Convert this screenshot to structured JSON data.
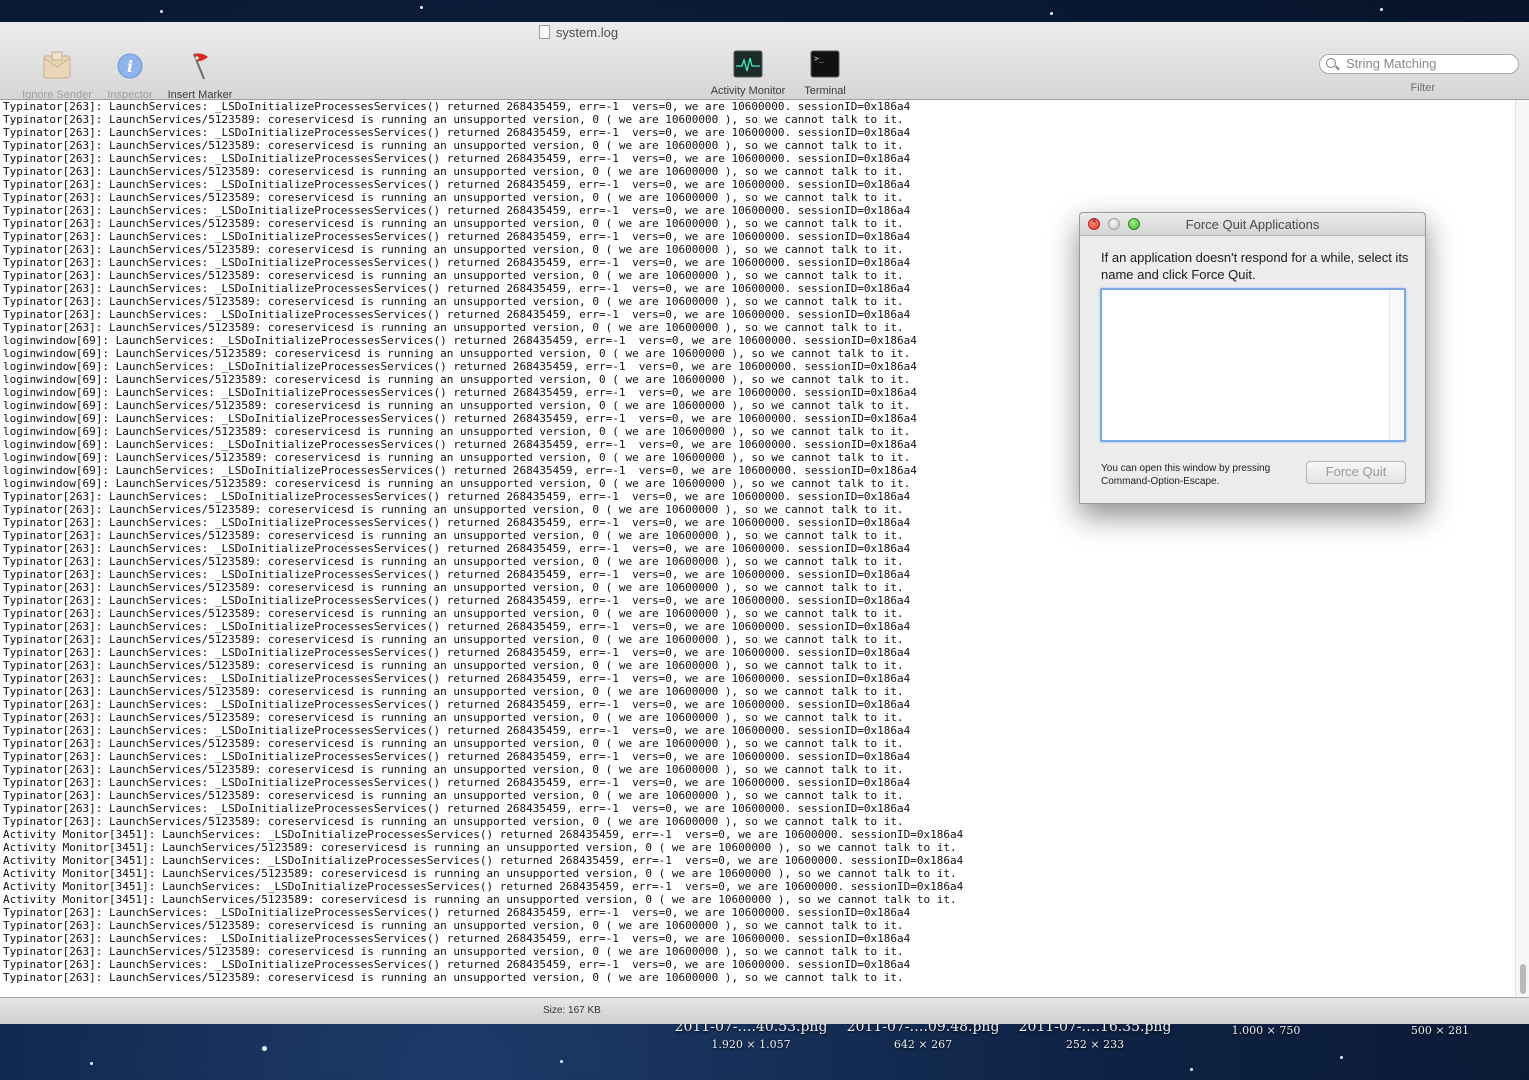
{
  "window": {
    "title": "system.log"
  },
  "toolbar": {
    "ignore_sender": "Ignore Sender",
    "inspector": "Inspector",
    "insert_marker": "Insert Marker",
    "activity_monitor": "Activity Monitor",
    "terminal": "Terminal"
  },
  "search": {
    "placeholder": "String Matching",
    "label": "Filter"
  },
  "log_lines": [
    "Typinator[263]: LaunchServices: _LSDoInitializeProcessesServices() returned 268435459, err=-1  vers=0, we are 10600000. sessionID=0x186a4",
    "Typinator[263]: LaunchServices/5123589: coreservicesd is running an unsupported version, 0 ( we are 10600000 ), so we cannot talk to it.",
    "Typinator[263]: LaunchServices: _LSDoInitializeProcessesServices() returned 268435459, err=-1  vers=0, we are 10600000. sessionID=0x186a4",
    "Typinator[263]: LaunchServices/5123589: coreservicesd is running an unsupported version, 0 ( we are 10600000 ), so we cannot talk to it.",
    "Typinator[263]: LaunchServices: _LSDoInitializeProcessesServices() returned 268435459, err=-1  vers=0, we are 10600000. sessionID=0x186a4",
    "Typinator[263]: LaunchServices/5123589: coreservicesd is running an unsupported version, 0 ( we are 10600000 ), so we cannot talk to it.",
    "Typinator[263]: LaunchServices: _LSDoInitializeProcessesServices() returned 268435459, err=-1  vers=0, we are 10600000. sessionID=0x186a4",
    "Typinator[263]: LaunchServices/5123589: coreservicesd is running an unsupported version, 0 ( we are 10600000 ), so we cannot talk to it.",
    "Typinator[263]: LaunchServices: _LSDoInitializeProcessesServices() returned 268435459, err=-1  vers=0, we are 10600000. sessionID=0x186a4",
    "Typinator[263]: LaunchServices/5123589: coreservicesd is running an unsupported version, 0 ( we are 10600000 ), so we cannot talk to it.",
    "Typinator[263]: LaunchServices: _LSDoInitializeProcessesServices() returned 268435459, err=-1  vers=0, we are 10600000. sessionID=0x186a4",
    "Typinator[263]: LaunchServices/5123589: coreservicesd is running an unsupported version, 0 ( we are 10600000 ), so we cannot talk to it.",
    "Typinator[263]: LaunchServices: _LSDoInitializeProcessesServices() returned 268435459, err=-1  vers=0, we are 10600000. sessionID=0x186a4",
    "Typinator[263]: LaunchServices/5123589: coreservicesd is running an unsupported version, 0 ( we are 10600000 ), so we cannot talk to it.",
    "Typinator[263]: LaunchServices: _LSDoInitializeProcessesServices() returned 268435459, err=-1  vers=0, we are 10600000. sessionID=0x186a4",
    "Typinator[263]: LaunchServices/5123589: coreservicesd is running an unsupported version, 0 ( we are 10600000 ), so we cannot talk to it.",
    "Typinator[263]: LaunchServices: _LSDoInitializeProcessesServices() returned 268435459, err=-1  vers=0, we are 10600000. sessionID=0x186a4",
    "Typinator[263]: LaunchServices/5123589: coreservicesd is running an unsupported version, 0 ( we are 10600000 ), so we cannot talk to it.",
    "loginwindow[69]: LaunchServices: _LSDoInitializeProcessesServices() returned 268435459, err=-1  vers=0, we are 10600000. sessionID=0x186a4",
    "loginwindow[69]: LaunchServices/5123589: coreservicesd is running an unsupported version, 0 ( we are 10600000 ), so we cannot talk to it.",
    "loginwindow[69]: LaunchServices: _LSDoInitializeProcessesServices() returned 268435459, err=-1  vers=0, we are 10600000. sessionID=0x186a4",
    "loginwindow[69]: LaunchServices/5123589: coreservicesd is running an unsupported version, 0 ( we are 10600000 ), so we cannot talk to it.",
    "loginwindow[69]: LaunchServices: _LSDoInitializeProcessesServices() returned 268435459, err=-1  vers=0, we are 10600000. sessionID=0x186a4",
    "loginwindow[69]: LaunchServices/5123589: coreservicesd is running an unsupported version, 0 ( we are 10600000 ), so we cannot talk to it.",
    "loginwindow[69]: LaunchServices: _LSDoInitializeProcessesServices() returned 268435459, err=-1  vers=0, we are 10600000. sessionID=0x186a4",
    "loginwindow[69]: LaunchServices/5123589: coreservicesd is running an unsupported version, 0 ( we are 10600000 ), so we cannot talk to it.",
    "loginwindow[69]: LaunchServices: _LSDoInitializeProcessesServices() returned 268435459, err=-1  vers=0, we are 10600000. sessionID=0x186a4",
    "loginwindow[69]: LaunchServices/5123589: coreservicesd is running an unsupported version, 0 ( we are 10600000 ), so we cannot talk to it.",
    "loginwindow[69]: LaunchServices: _LSDoInitializeProcessesServices() returned 268435459, err=-1  vers=0, we are 10600000. sessionID=0x186a4",
    "loginwindow[69]: LaunchServices/5123589: coreservicesd is running an unsupported version, 0 ( we are 10600000 ), so we cannot talk to it.",
    "Typinator[263]: LaunchServices: _LSDoInitializeProcessesServices() returned 268435459, err=-1  vers=0, we are 10600000. sessionID=0x186a4",
    "Typinator[263]: LaunchServices/5123589: coreservicesd is running an unsupported version, 0 ( we are 10600000 ), so we cannot talk to it.",
    "Typinator[263]: LaunchServices: _LSDoInitializeProcessesServices() returned 268435459, err=-1  vers=0, we are 10600000. sessionID=0x186a4",
    "Typinator[263]: LaunchServices/5123589: coreservicesd is running an unsupported version, 0 ( we are 10600000 ), so we cannot talk to it.",
    "Typinator[263]: LaunchServices: _LSDoInitializeProcessesServices() returned 268435459, err=-1  vers=0, we are 10600000. sessionID=0x186a4",
    "Typinator[263]: LaunchServices/5123589: coreservicesd is running an unsupported version, 0 ( we are 10600000 ), so we cannot talk to it.",
    "Typinator[263]: LaunchServices: _LSDoInitializeProcessesServices() returned 268435459, err=-1  vers=0, we are 10600000. sessionID=0x186a4",
    "Typinator[263]: LaunchServices/5123589: coreservicesd is running an unsupported version, 0 ( we are 10600000 ), so we cannot talk to it.",
    "Typinator[263]: LaunchServices: _LSDoInitializeProcessesServices() returned 268435459, err=-1  vers=0, we are 10600000. sessionID=0x186a4",
    "Typinator[263]: LaunchServices/5123589: coreservicesd is running an unsupported version, 0 ( we are 10600000 ), so we cannot talk to it.",
    "Typinator[263]: LaunchServices: _LSDoInitializeProcessesServices() returned 268435459, err=-1  vers=0, we are 10600000. sessionID=0x186a4",
    "Typinator[263]: LaunchServices/5123589: coreservicesd is running an unsupported version, 0 ( we are 10600000 ), so we cannot talk to it.",
    "Typinator[263]: LaunchServices: _LSDoInitializeProcessesServices() returned 268435459, err=-1  vers=0, we are 10600000. sessionID=0x186a4",
    "Typinator[263]: LaunchServices/5123589: coreservicesd is running an unsupported version, 0 ( we are 10600000 ), so we cannot talk to it.",
    "Typinator[263]: LaunchServices: _LSDoInitializeProcessesServices() returned 268435459, err=-1  vers=0, we are 10600000. sessionID=0x186a4",
    "Typinator[263]: LaunchServices/5123589: coreservicesd is running an unsupported version, 0 ( we are 10600000 ), so we cannot talk to it.",
    "Typinator[263]: LaunchServices: _LSDoInitializeProcessesServices() returned 268435459, err=-1  vers=0, we are 10600000. sessionID=0x186a4",
    "Typinator[263]: LaunchServices/5123589: coreservicesd is running an unsupported version, 0 ( we are 10600000 ), so we cannot talk to it.",
    "Typinator[263]: LaunchServices: _LSDoInitializeProcessesServices() returned 268435459, err=-1  vers=0, we are 10600000. sessionID=0x186a4",
    "Typinator[263]: LaunchServices/5123589: coreservicesd is running an unsupported version, 0 ( we are 10600000 ), so we cannot talk to it.",
    "Typinator[263]: LaunchServices: _LSDoInitializeProcessesServices() returned 268435459, err=-1  vers=0, we are 10600000. sessionID=0x186a4",
    "Typinator[263]: LaunchServices/5123589: coreservicesd is running an unsupported version, 0 ( we are 10600000 ), so we cannot talk to it.",
    "Typinator[263]: LaunchServices: _LSDoInitializeProcessesServices() returned 268435459, err=-1  vers=0, we are 10600000. sessionID=0x186a4",
    "Typinator[263]: LaunchServices/5123589: coreservicesd is running an unsupported version, 0 ( we are 10600000 ), so we cannot talk to it.",
    "Typinator[263]: LaunchServices: _LSDoInitializeProcessesServices() returned 268435459, err=-1  vers=0, we are 10600000. sessionID=0x186a4",
    "Typinator[263]: LaunchServices/5123589: coreservicesd is running an unsupported version, 0 ( we are 10600000 ), so we cannot talk to it.",
    "Activity Monitor[3451]: LaunchServices: _LSDoInitializeProcessesServices() returned 268435459, err=-1  vers=0, we are 10600000. sessionID=0x186a4",
    "Activity Monitor[3451]: LaunchServices/5123589: coreservicesd is running an unsupported version, 0 ( we are 10600000 ), so we cannot talk to it.",
    "Activity Monitor[3451]: LaunchServices: _LSDoInitializeProcessesServices() returned 268435459, err=-1  vers=0, we are 10600000. sessionID=0x186a4",
    "Activity Monitor[3451]: LaunchServices/5123589: coreservicesd is running an unsupported version, 0 ( we are 10600000 ), so we cannot talk to it.",
    "Activity Monitor[3451]: LaunchServices: _LSDoInitializeProcessesServices() returned 268435459, err=-1  vers=0, we are 10600000. sessionID=0x186a4",
    "Activity Monitor[3451]: LaunchServices/5123589: coreservicesd is running an unsupported version, 0 ( we are 10600000 ), so we cannot talk to it.",
    "Typinator[263]: LaunchServices: _LSDoInitializeProcessesServices() returned 268435459, err=-1  vers=0, we are 10600000. sessionID=0x186a4",
    "Typinator[263]: LaunchServices/5123589: coreservicesd is running an unsupported version, 0 ( we are 10600000 ), so we cannot talk to it.",
    "Typinator[263]: LaunchServices: _LSDoInitializeProcessesServices() returned 268435459, err=-1  vers=0, we are 10600000. sessionID=0x186a4",
    "Typinator[263]: LaunchServices/5123589: coreservicesd is running an unsupported version, 0 ( we are 10600000 ), so we cannot talk to it.",
    "Typinator[263]: LaunchServices: _LSDoInitializeProcessesServices() returned 268435459, err=-1  vers=0, we are 10600000. sessionID=0x186a4",
    "Typinator[263]: LaunchServices/5123589: coreservicesd is running an unsupported version, 0 ( we are 10600000 ), so we cannot talk to it."
  ],
  "status": {
    "size": "Size: 167 KB"
  },
  "dialog": {
    "title": "Force Quit Applications",
    "message": "If an application doesn't respond for a while, select its name and click Force Quit.",
    "hint": "You can open this window by pressing Command-Option-Escape.",
    "button": "Force Quit"
  },
  "desktop_files": [
    {
      "name": "2011-07-….40.53.png",
      "dims": "1.920 × 1.057"
    },
    {
      "name": "2011-07-….09.48.png",
      "dims": "642 × 267"
    },
    {
      "name": "2011-07-….16.35.png",
      "dims": "252 × 233"
    },
    {
      "name": "",
      "dims": "1.000 × 750"
    },
    {
      "name": "",
      "dims": "500 × 281"
    }
  ],
  "colors": {
    "desktop": "#0d2142",
    "accent": "#7aa8e2",
    "close": "#d9342b",
    "zoom": "#3fae2e"
  }
}
